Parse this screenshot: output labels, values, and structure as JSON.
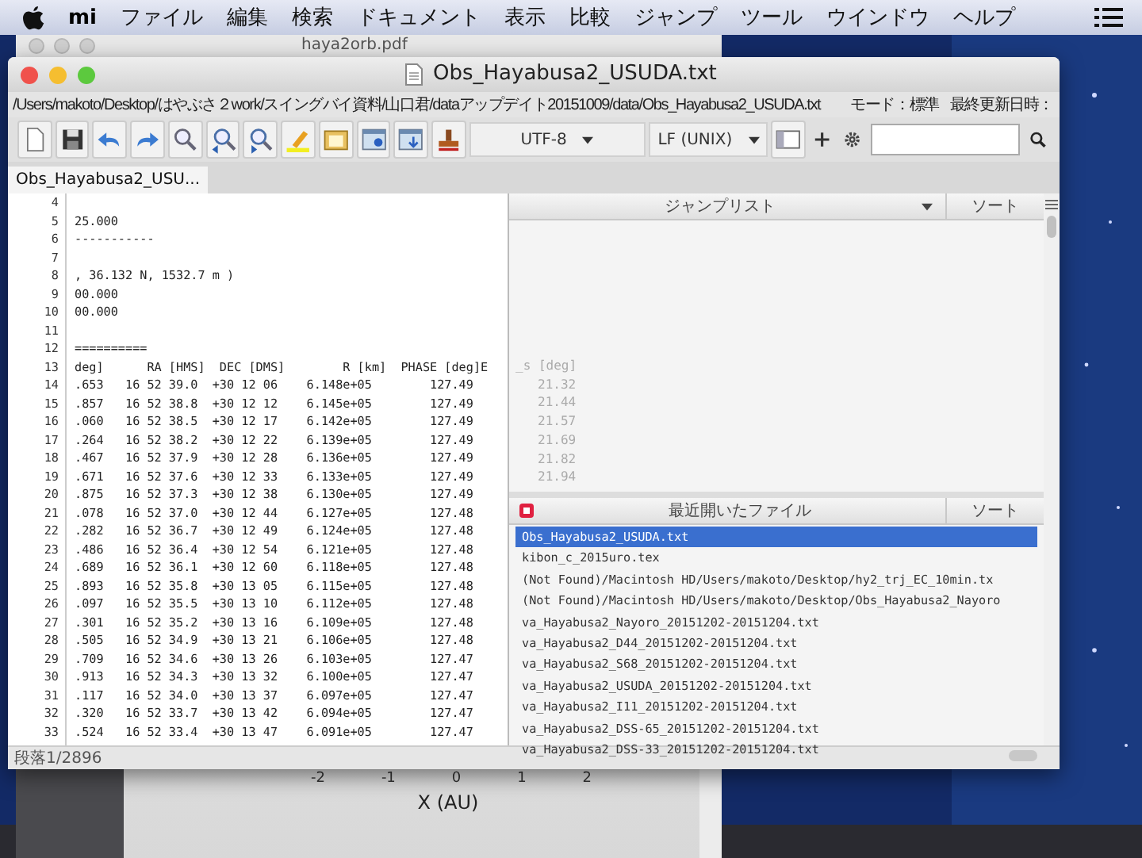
{
  "menu_bar": {
    "app_name": "mi",
    "items": [
      "ファイル",
      "編集",
      "検索",
      "ドキュメント",
      "表示",
      "比較",
      "ジャンプ",
      "ツール",
      "ウインドウ",
      "ヘルプ"
    ]
  },
  "background_window": {
    "title": "haya2orb.pdf",
    "axis_ticks": [
      "-2",
      "-1",
      "0",
      "1",
      "2"
    ],
    "axis_label": "X (AU)"
  },
  "window": {
    "title": "Obs_Hayabusa2_USUDA.txt",
    "path": "/Users/makoto/Desktop/はやぶさ２work/スイングバイ資料/山口君/dataアップデイト20151009/data/Obs_Hayabusa2_USUDA.txt",
    "mode": "モード：標準",
    "modified": "最終更新日時："
  },
  "toolbar": {
    "encoding": "UTF-8",
    "line_ending": "LF (UNIX)"
  },
  "tabs": [
    {
      "label": "Obs_Hayabusa2_USU...",
      "selected": true
    }
  ],
  "editor": {
    "lines": [
      {
        "num": "4"
      },
      {
        "num": "5",
        "text": "25.000"
      },
      {
        "num": "6",
        "text": "-----------"
      },
      {
        "num": "7"
      },
      {
        "num": "8",
        "text": ", 36.132 N, 1532.7 m )"
      },
      {
        "num": "9",
        "text": "00.000"
      },
      {
        "num": "10",
        "text": "00.000"
      },
      {
        "num": "11"
      },
      {
        "num": "12",
        "text": "=========="
      },
      {
        "num": "13",
        "text": "deg]      RA [HMS]  DEC [DMS]        R [km]  PHASE [deg]E"
      },
      {
        "num": "14",
        "text": ".653   16 52 39.0  +30 12 06    6.148e+05        127.49"
      },
      {
        "num": "15",
        "text": ".857   16 52 38.8  +30 12 12    6.145e+05        127.49"
      },
      {
        "num": "16",
        "text": ".060   16 52 38.5  +30 12 17    6.142e+05        127.49"
      },
      {
        "num": "17",
        "text": ".264   16 52 38.2  +30 12 22    6.139e+05        127.49"
      },
      {
        "num": "18",
        "text": ".467   16 52 37.9  +30 12 28    6.136e+05        127.49"
      },
      {
        "num": "19",
        "text": ".671   16 52 37.6  +30 12 33    6.133e+05        127.49"
      },
      {
        "num": "20",
        "text": ".875   16 52 37.3  +30 12 38    6.130e+05        127.49"
      },
      {
        "num": "21",
        "text": ".078   16 52 37.0  +30 12 44    6.127e+05        127.48"
      },
      {
        "num": "22",
        "text": ".282   16 52 36.7  +30 12 49    6.124e+05        127.48"
      },
      {
        "num": "23",
        "text": ".486   16 52 36.4  +30 12 54    6.121e+05        127.48"
      },
      {
        "num": "24",
        "text": ".689   16 52 36.1  +30 12 60    6.118e+05        127.48"
      },
      {
        "num": "25",
        "text": ".893   16 52 35.8  +30 13 05    6.115e+05        127.48"
      },
      {
        "num": "26",
        "text": ".097   16 52 35.5  +30 13 10    6.112e+05        127.48"
      },
      {
        "num": "27",
        "text": ".301   16 52 35.2  +30 13 16    6.109e+05        127.48"
      },
      {
        "num": "28",
        "text": ".505   16 52 34.9  +30 13 21    6.106e+05        127.48"
      },
      {
        "num": "29",
        "text": ".709   16 52 34.6  +30 13 26    6.103e+05        127.47"
      },
      {
        "num": "30",
        "text": ".913   16 52 34.3  +30 13 32    6.100e+05        127.47"
      },
      {
        "num": "31",
        "text": ".117   16 52 34.0  +30 13 37    6.097e+05        127.47"
      },
      {
        "num": "32",
        "text": ".320   16 52 33.7  +30 13 42    6.094e+05        127.47"
      },
      {
        "num": "33",
        "text": ".524   16 52 33.4  +30 13 47    6.091e+05        127.47"
      }
    ]
  },
  "jump_list": {
    "title": "ジャンプリスト",
    "sort": "ソート",
    "ghost_text": [
      "_s [deg]",
      "21.32",
      "21.44",
      "21.57",
      "21.69",
      "21.82",
      "21.94"
    ]
  },
  "recent_files": {
    "title": "最近開いたファイル",
    "sort": "ソート",
    "items": [
      {
        "name": "Obs_Hayabusa2_USUDA.txt",
        "selected": true
      },
      {
        "name": "kibon_c_2015uro.tex",
        "selected": false
      },
      {
        "name": "(Not Found)/Macintosh HD/Users/makoto/Desktop/hy2_trj_EC_10min.tx",
        "selected": false
      },
      {
        "name": "(Not Found)/Macintosh HD/Users/makoto/Desktop/Obs_Hayabusa2_Nayoro",
        "selected": false
      },
      {
        "name": "va_Hayabusa2_Nayoro_20151202-20151204.txt",
        "selected": false
      },
      {
        "name": "va_Hayabusa2_D44_20151202-20151204.txt",
        "selected": false
      },
      {
        "name": "va_Hayabusa2_S68_20151202-20151204.txt",
        "selected": false
      },
      {
        "name": "va_Hayabusa2_USUDA_20151202-20151204.txt",
        "selected": false
      },
      {
        "name": "va_Hayabusa2_I11_20151202-20151204.txt",
        "selected": false
      },
      {
        "name": "va_Hayabusa2_DSS-65_20151202-20151204.txt",
        "selected": false
      },
      {
        "name": "va_Hayabusa2_DSS-33_20151202-20151204.txt",
        "selected": false
      }
    ]
  },
  "status_bar": {
    "paragraph": "段落1/2896"
  }
}
